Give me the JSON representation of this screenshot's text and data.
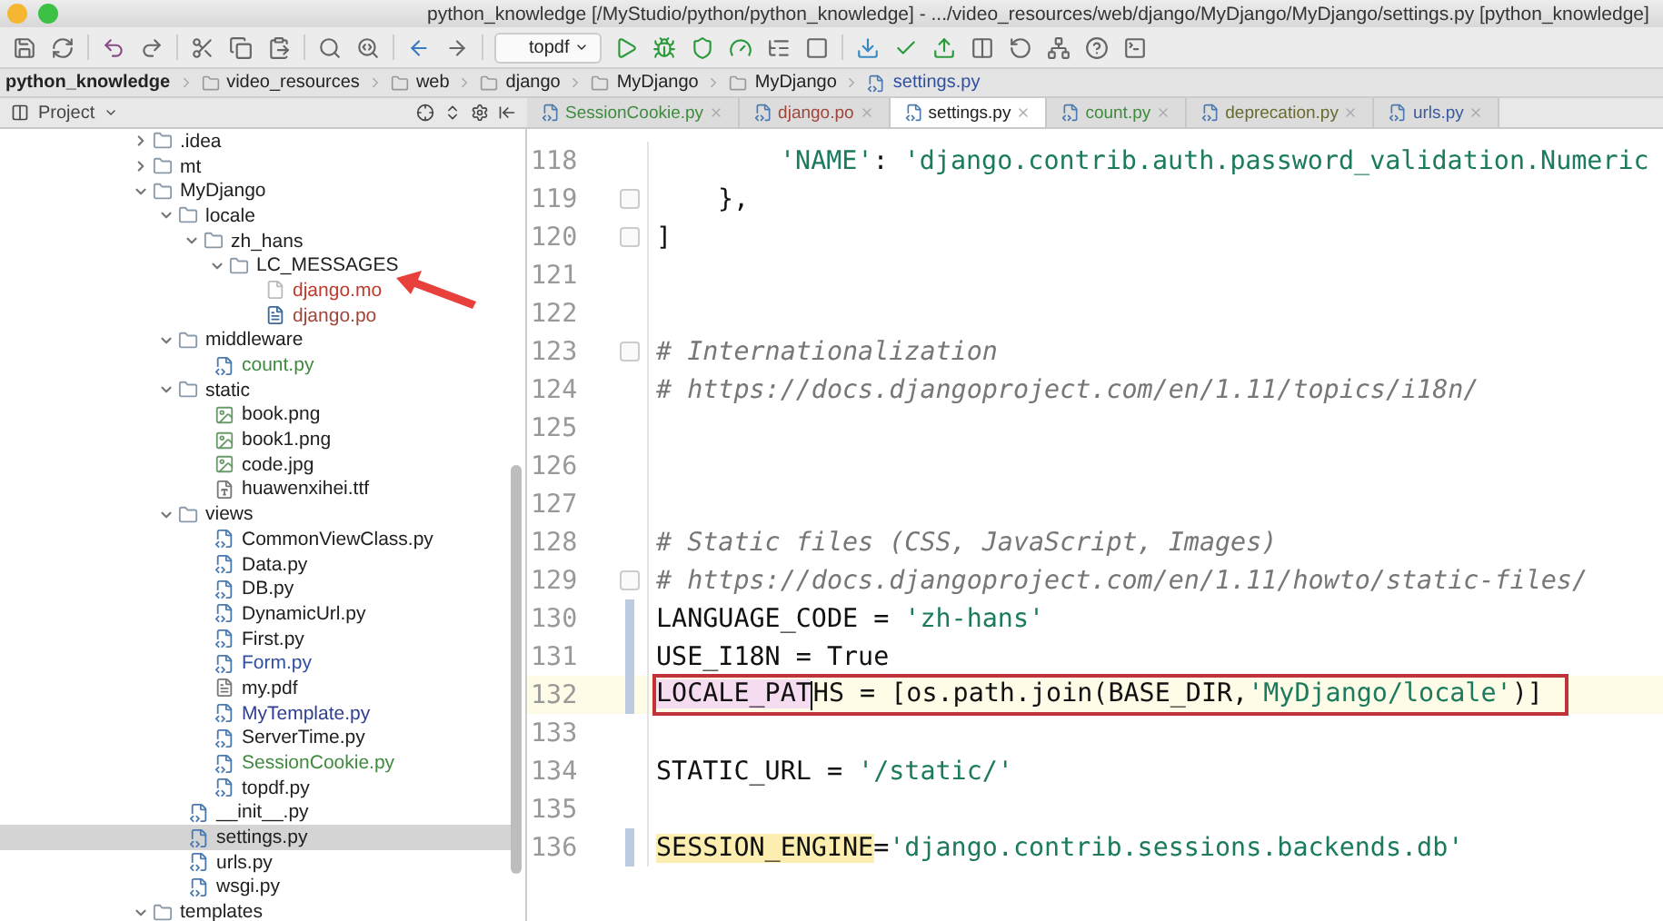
{
  "window": {
    "title": "python_knowledge [/MyStudio/python/python_knowledge] - .../video_resources/web/django/MyDjango/MyDjango/settings.py [python_knowledge]"
  },
  "toolbar": [
    {
      "kind": "save"
    },
    {
      "kind": "sync"
    },
    {
      "kind": "sep"
    },
    {
      "kind": "undo"
    },
    {
      "kind": "redo"
    },
    {
      "kind": "sep"
    },
    {
      "kind": "cut"
    },
    {
      "kind": "copy"
    },
    {
      "kind": "paste"
    },
    {
      "kind": "sep"
    },
    {
      "kind": "find"
    },
    {
      "kind": "replace"
    },
    {
      "kind": "sep"
    },
    {
      "kind": "back"
    },
    {
      "kind": "forward"
    },
    {
      "kind": "sep"
    },
    {
      "kind": "config",
      "label": "topdf"
    },
    {
      "kind": "run"
    },
    {
      "kind": "debug"
    },
    {
      "kind": "coverage"
    },
    {
      "kind": "profile"
    },
    {
      "kind": "build"
    },
    {
      "kind": "stop"
    },
    {
      "kind": "sep"
    },
    {
      "kind": "vcs-update"
    },
    {
      "kind": "vcs-commit"
    },
    {
      "kind": "vcs-push"
    },
    {
      "kind": "compare"
    },
    {
      "kind": "revert"
    },
    {
      "kind": "structure"
    },
    {
      "kind": "help"
    },
    {
      "kind": "terminal"
    }
  ],
  "breadcrumbs": [
    {
      "kind": "project",
      "label": "python_knowledge"
    },
    {
      "kind": "folder",
      "label": "video_resources"
    },
    {
      "kind": "folder",
      "label": "web"
    },
    {
      "kind": "folder",
      "label": "django"
    },
    {
      "kind": "folder",
      "label": "MyDjango"
    },
    {
      "kind": "folder",
      "label": "MyDjango"
    },
    {
      "kind": "file",
      "label": "settings.py"
    }
  ],
  "project_panel": {
    "title": "Project"
  },
  "tabs": [
    {
      "label": "SessionCookie.py",
      "color": "#3f8a3f",
      "selected": false
    },
    {
      "label": "django.po",
      "color": "#a0453a",
      "selected": false
    },
    {
      "label": "settings.py",
      "color": "#202020",
      "selected": true
    },
    {
      "label": "count.py",
      "color": "#3f8a3f",
      "selected": false
    },
    {
      "label": "deprecation.py",
      "color": "#6a6a30",
      "selected": false
    },
    {
      "label": "urls.py",
      "color": "#3a5aa0",
      "selected": false
    }
  ],
  "tree": [
    {
      "kind": "folder",
      "label": ".idea",
      "expanded": false
    },
    {
      "kind": "folder",
      "label": "mt",
      "expanded": false
    },
    {
      "kind": "folder",
      "label": "MyDjango",
      "expanded": true,
      "children": [
        {
          "kind": "folder",
          "label": "locale",
          "expanded": true,
          "children": [
            {
              "kind": "folder",
              "label": "zh_hans",
              "expanded": true,
              "children": [
                {
                  "kind": "folder",
                  "label": "LC_MESSAGES",
                  "expanded": true,
                  "children": [
                    {
                      "kind": "blank",
                      "label": "django.mo",
                      "color": "#c0392b",
                      "selected": false,
                      "pointed": true
                    },
                    {
                      "kind": "po",
                      "label": "django.po",
                      "color": "#a0453a",
                      "selected": false,
                      "pointed": false
                    }
                  ]
                }
              ]
            }
          ]
        },
        {
          "kind": "folder",
          "label": "middleware",
          "expanded": true,
          "children": [
            {
              "kind": "python",
              "label": "count.py",
              "color": "#3f8a3f",
              "selected": false,
              "pointed": false
            }
          ]
        },
        {
          "kind": "folder",
          "label": "static",
          "expanded": true,
          "children": [
            {
              "kind": "image",
              "label": "book.png",
              "color": "#202020",
              "selected": false,
              "pointed": false
            },
            {
              "kind": "image",
              "label": "book1.png",
              "color": "#202020",
              "selected": false,
              "pointed": false
            },
            {
              "kind": "image",
              "label": "code.jpg",
              "color": "#202020",
              "selected": false,
              "pointed": false
            },
            {
              "kind": "font",
              "label": "huawenxihei.ttf",
              "color": "#202020",
              "selected": false,
              "pointed": false
            }
          ]
        },
        {
          "kind": "folder",
          "label": "views",
          "expanded": true,
          "children": [
            {
              "kind": "python",
              "label": "CommonViewClass.py",
              "color": "#202020",
              "selected": false,
              "pointed": false
            },
            {
              "kind": "python",
              "label": "Data.py",
              "color": "#202020",
              "selected": false,
              "pointed": false
            },
            {
              "kind": "python",
              "label": "DB.py",
              "color": "#202020",
              "selected": false,
              "pointed": false
            },
            {
              "kind": "python",
              "label": "DynamicUrl.py",
              "color": "#202020",
              "selected": false,
              "pointed": false
            },
            {
              "kind": "python",
              "label": "First.py",
              "color": "#202020",
              "selected": false,
              "pointed": false
            },
            {
              "kind": "python",
              "label": "Form.py",
              "color": "#2f4fa0",
              "selected": false,
              "pointed": false
            },
            {
              "kind": "pdf",
              "label": "my.pdf",
              "color": "#202020",
              "selected": false,
              "pointed": false
            },
            {
              "kind": "python",
              "label": "MyTemplate.py",
              "color": "#2f3f90",
              "selected": false,
              "pointed": false
            },
            {
              "kind": "python",
              "label": "ServerTime.py",
              "color": "#202020",
              "selected": false,
              "pointed": false
            },
            {
              "kind": "python",
              "label": "SessionCookie.py",
              "color": "#3f8a3f",
              "selected": false,
              "pointed": false
            },
            {
              "kind": "python",
              "label": "topdf.py",
              "color": "#202020",
              "selected": false,
              "pointed": false
            }
          ]
        },
        {
          "kind": "python",
          "label": "__init__.py",
          "color": "#202020",
          "selected": false,
          "pointed": false
        },
        {
          "kind": "python",
          "label": "settings.py",
          "color": "#202020",
          "selected": true,
          "pointed": false
        },
        {
          "kind": "python",
          "label": "urls.py",
          "color": "#202020",
          "selected": false,
          "pointed": false
        },
        {
          "kind": "python",
          "label": "wsgi.py",
          "color": "#202020",
          "selected": false,
          "pointed": false
        }
      ]
    },
    {
      "kind": "folder",
      "label": "templates",
      "expanded": true
    }
  ],
  "code": [
    {
      "number": "118",
      "indented": true,
      "nested": true,
      "changed": false,
      "fold": false,
      "current": false,
      "boxed": false,
      "tokens": [
        {
          "kind": "string",
          "text": "'NAME'"
        },
        {
          "kind": "plain",
          "text": ": "
        },
        {
          "kind": "string",
          "text": "'django.contrib.auth.password_validation.Numeric"
        }
      ]
    },
    {
      "number": "119",
      "indented": true,
      "nested": false,
      "changed": false,
      "fold": true,
      "current": false,
      "boxed": false,
      "tokens": [
        {
          "kind": "plain",
          "text": "},"
        }
      ]
    },
    {
      "number": "120",
      "changed": false,
      "fold": true,
      "current": false,
      "boxed": false,
      "tokens": [
        {
          "kind": "plain",
          "text": "]"
        }
      ]
    },
    {
      "number": "121",
      "changed": false,
      "fold": false,
      "current": false,
      "boxed": false
    },
    {
      "number": "122",
      "changed": false,
      "fold": false,
      "current": false,
      "boxed": false
    },
    {
      "number": "123",
      "changed": false,
      "fold": true,
      "current": false,
      "boxed": false,
      "tokens": [
        {
          "kind": "comment",
          "text": "# Internationalization"
        }
      ]
    },
    {
      "number": "124",
      "changed": false,
      "fold": false,
      "current": false,
      "boxed": false,
      "tokens": [
        {
          "kind": "comment",
          "text": "# https://docs.djangoproject.com/en/1.11/topics/i18n/"
        }
      ]
    },
    {
      "number": "125",
      "changed": false,
      "fold": false,
      "current": false,
      "boxed": false
    },
    {
      "number": "126",
      "changed": false,
      "fold": false,
      "current": false,
      "boxed": false
    },
    {
      "number": "127",
      "changed": false,
      "fold": false,
      "current": false,
      "boxed": false
    },
    {
      "number": "128",
      "changed": false,
      "fold": false,
      "current": false,
      "boxed": false,
      "tokens": [
        {
          "kind": "comment",
          "text": "# Static files (CSS, JavaScript, Images)"
        }
      ]
    },
    {
      "number": "129",
      "changed": false,
      "fold": true,
      "current": false,
      "boxed": false,
      "tokens": [
        {
          "kind": "comment",
          "text": "# https://docs.djangoproject.com/en/1.11/howto/static-files/"
        }
      ]
    },
    {
      "number": "130",
      "changed": true,
      "fold": false,
      "current": false,
      "boxed": false,
      "tokens": [
        {
          "kind": "plain",
          "text": "LANGUAGE_CODE = "
        },
        {
          "kind": "string",
          "text": "'zh-hans'"
        }
      ]
    },
    {
      "number": "131",
      "changed": true,
      "fold": false,
      "current": false,
      "boxed": false,
      "tokens": [
        {
          "kind": "plain",
          "text": "USE_I18N = True"
        }
      ]
    },
    {
      "number": "132",
      "changed": true,
      "fold": false,
      "current": true,
      "boxed": true,
      "tokens": [
        {
          "kind": "marked",
          "text": "LOCALE_PAT"
        },
        {
          "kind": "plain",
          "text": "HS = [os.path.join(BASE_DIR,"
        },
        {
          "kind": "string",
          "text": "'MyDjango/locale'"
        },
        {
          "kind": "plain",
          "text": ")]"
        }
      ]
    },
    {
      "number": "133",
      "changed": false,
      "fold": false,
      "current": false,
      "boxed": false
    },
    {
      "number": "134",
      "changed": false,
      "fold": false,
      "current": false,
      "boxed": false,
      "tokens": [
        {
          "kind": "plain",
          "text": "STATIC_URL = "
        },
        {
          "kind": "string",
          "text": "'/static/'"
        }
      ]
    },
    {
      "number": "135",
      "changed": false,
      "fold": false,
      "current": false,
      "boxed": false
    },
    {
      "number": "136",
      "changed": true,
      "fold": false,
      "current": false,
      "boxed": false,
      "tokens": [
        {
          "kind": "highlight",
          "text": "SESSION_ENGINE"
        },
        {
          "kind": "plain",
          "text": "="
        },
        {
          "kind": "string",
          "text": "'django.contrib.sessions.backends.db'"
        }
      ]
    }
  ]
}
